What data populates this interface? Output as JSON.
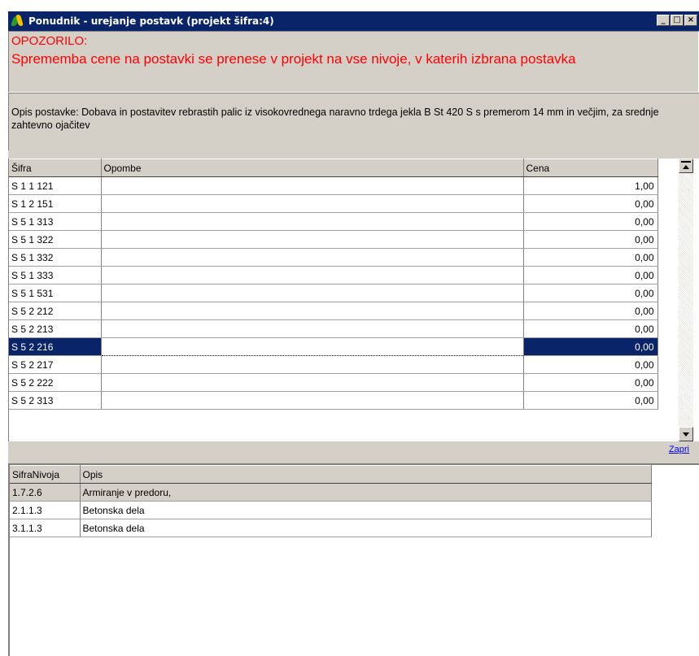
{
  "window": {
    "title": "Ponudnik - urejanje postavk (projekt šifra:4)",
    "minimize": "_",
    "maximize": "□",
    "close": "×"
  },
  "warning": {
    "heading": "OPOZORILO:",
    "message": "Sprememba cene na postavki se prenese v projekt na vse nivoje, v katerih izbrana postavka"
  },
  "description": {
    "text": "Opis postavke:  Dobava in postavitev rebrastih palic iz visokovrednega naravno trdega jekla B St 420 S s premerom 14 mm in večjim, za srednje zahtevno ojačitev"
  },
  "items_grid": {
    "columns": [
      "Šifra",
      "Opombe",
      "Cena"
    ],
    "rows": [
      {
        "sifra": "S 1 1 121",
        "opombe": "",
        "cena": "1,00"
      },
      {
        "sifra": "S 1 2 151",
        "opombe": "",
        "cena": "0,00"
      },
      {
        "sifra": "S 5 1 313",
        "opombe": "",
        "cena": "0,00"
      },
      {
        "sifra": "S 5 1 322",
        "opombe": "",
        "cena": "0,00"
      },
      {
        "sifra": "S 5 1 332",
        "opombe": "",
        "cena": "0,00"
      },
      {
        "sifra": "S 5 1 333",
        "opombe": "",
        "cena": "0,00"
      },
      {
        "sifra": "S 5 1 531",
        "opombe": "",
        "cena": "0,00"
      },
      {
        "sifra": "S 5 2 212",
        "opombe": "",
        "cena": "0,00"
      },
      {
        "sifra": "S 5 2 213",
        "opombe": "",
        "cena": "0,00"
      },
      {
        "sifra": "S 5 2 216",
        "opombe": "",
        "cena": "0,00"
      },
      {
        "sifra": "S 5 2 217",
        "opombe": "",
        "cena": "0,00"
      },
      {
        "sifra": "S 5 2 222",
        "opombe": "",
        "cena": "0,00"
      },
      {
        "sifra": "S 5 2 313",
        "opombe": "",
        "cena": "0,00"
      }
    ],
    "selected_row": 9
  },
  "close_link": "Zapri",
  "levels_grid": {
    "columns": [
      "SifraNivoja",
      "Opis"
    ],
    "rows": [
      {
        "sifra": "1.7.2.6",
        "opis": "Armiranje v predoru,"
      },
      {
        "sifra": "2.1.1.3",
        "opis": "Betonska dela"
      },
      {
        "sifra": "3.1.1.3",
        "opis": "Betonska dela"
      }
    ]
  },
  "colors": {
    "titlebar": "#0a246a",
    "warning_text": "#ff0000",
    "selection": "#0a246a",
    "face": "#d4d0c8",
    "link": "#0000ee"
  }
}
